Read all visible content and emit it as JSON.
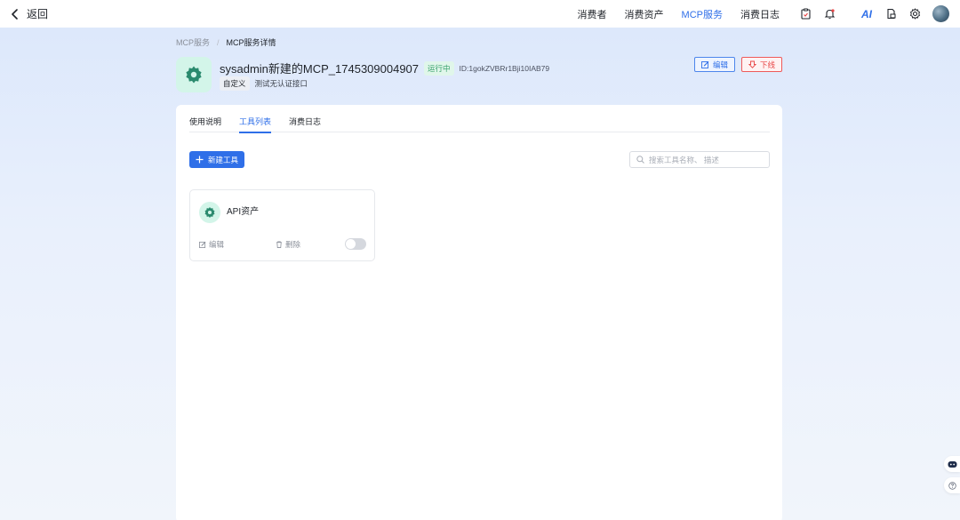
{
  "topbar": {
    "back_label": "返回",
    "nav": [
      {
        "label": "消费者"
      },
      {
        "label": "消费资产"
      },
      {
        "label": "MCP服务"
      },
      {
        "label": "消费日志"
      }
    ],
    "ai_label": "AI"
  },
  "breadcrumb": {
    "parent": "MCP服务",
    "current": "MCP服务详情"
  },
  "service": {
    "title": "sysadmin新建的MCP_1745309004907",
    "status": "运行中",
    "id_text": "ID:1gokZVBRr1Bji10IAB79",
    "tag": "自定义",
    "description": "测试无认证接口",
    "edit_label": "编辑",
    "offline_label": "下线"
  },
  "tabs": [
    {
      "label": "使用说明"
    },
    {
      "label": "工具列表"
    },
    {
      "label": "消费日志"
    }
  ],
  "toolbar": {
    "new_tool_label": "新建工具",
    "search_placeholder": "搜索工具名称、 描述"
  },
  "tools": [
    {
      "name": "API资产",
      "edit_label": "编辑",
      "delete_label": "删除",
      "enabled": false
    }
  ],
  "colors": {
    "accent": "#2f6fe8",
    "danger": "#e84444",
    "status_green": "#37a16b",
    "icon_bg": "#d3f5e9",
    "icon_fg": "#2a8a6e"
  }
}
